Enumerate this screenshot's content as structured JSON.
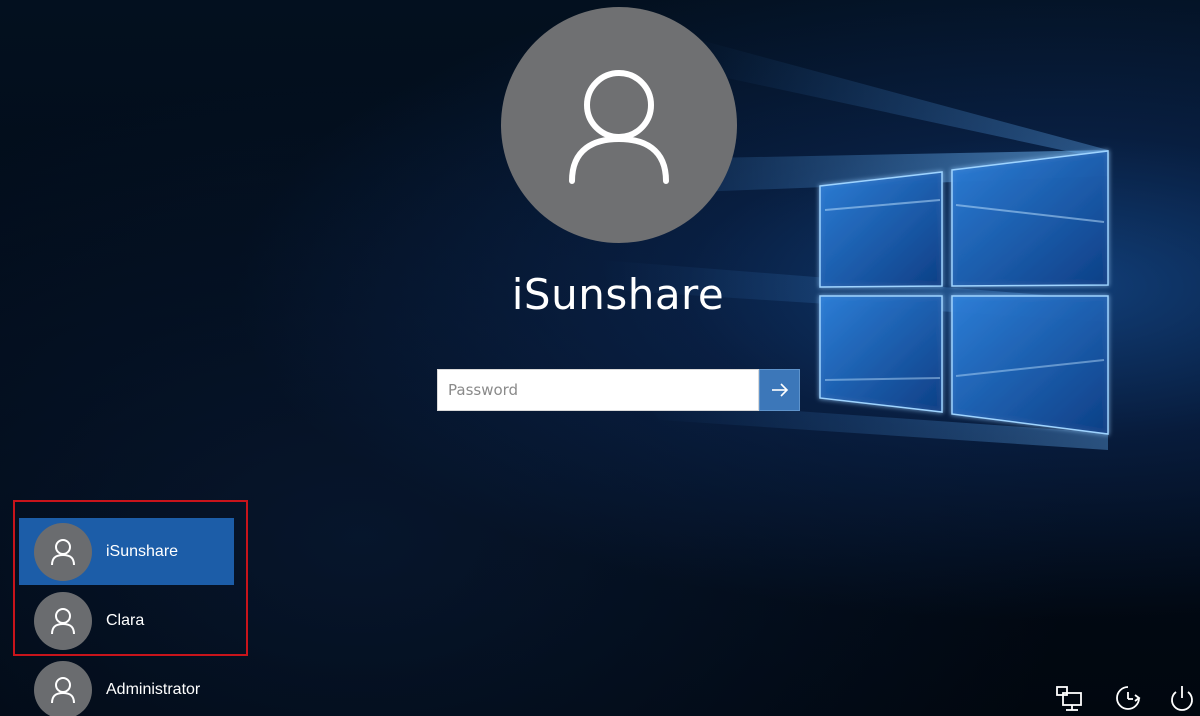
{
  "current_user": {
    "name": "iSunshare"
  },
  "password_field": {
    "placeholder": "Password",
    "value": ""
  },
  "user_list": [
    {
      "name": "iSunshare",
      "selected": true
    },
    {
      "name": "Clara",
      "selected": false
    },
    {
      "name": "Administrator",
      "selected": false
    }
  ],
  "tray": {
    "icons": [
      "network-icon",
      "ease-of-access-icon",
      "power-icon"
    ]
  },
  "colors": {
    "selected_user": "#1c5da8",
    "submit_button": "#3c77b9",
    "highlight_box": "#c8141b",
    "avatar": "#6f7072"
  }
}
